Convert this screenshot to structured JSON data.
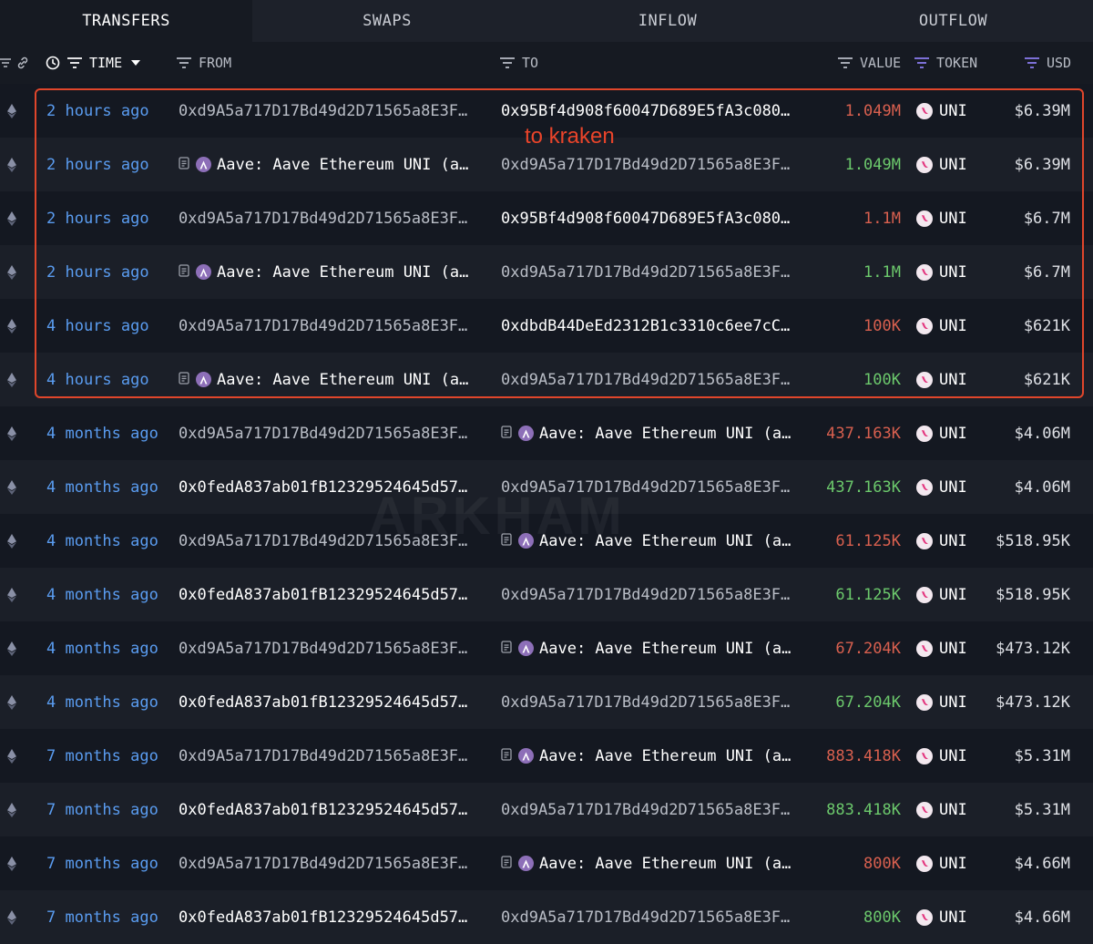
{
  "tabs": [
    "TRANSFERS",
    "SWAPS",
    "INFLOW",
    "OUTFLOW"
  ],
  "active_tab": "TRANSFERS",
  "header": {
    "time": "TIME",
    "from": "FROM",
    "to": "TO",
    "value": "VALUE",
    "token": "TOKEN",
    "usd": "USD"
  },
  "annotation": "to kraken",
  "watermark": "ARKHAM",
  "colors": {
    "out": "#d9604f",
    "in": "#6cc96c",
    "time_link": "#5a9cf0",
    "highlight": "#e0462b"
  },
  "rows": [
    {
      "time": "2 hours ago",
      "from": "0xd9A5a717D17Bd49d2D71565a8E3F…",
      "from_type": "addr",
      "to": "0x95Bf4d908f60047D689E5fA3c080…",
      "to_type": "addr-bold",
      "value": "1.049M",
      "direction": "out",
      "token": "UNI",
      "usd": "$6.39M"
    },
    {
      "time": "2 hours ago",
      "from": "Aave: Aave Ethereum UNI (a…",
      "from_type": "entity",
      "to": "0xd9A5a717D17Bd49d2D71565a8E3F…",
      "to_type": "addr",
      "value": "1.049M",
      "direction": "in",
      "token": "UNI",
      "usd": "$6.39M"
    },
    {
      "time": "2 hours ago",
      "from": "0xd9A5a717D17Bd49d2D71565a8E3F…",
      "from_type": "addr",
      "to": "0x95Bf4d908f60047D689E5fA3c080…",
      "to_type": "addr-bold",
      "value": "1.1M",
      "direction": "out",
      "token": "UNI",
      "usd": "$6.7M"
    },
    {
      "time": "2 hours ago",
      "from": "Aave: Aave Ethereum UNI (a…",
      "from_type": "entity",
      "to": "0xd9A5a717D17Bd49d2D71565a8E3F…",
      "to_type": "addr",
      "value": "1.1M",
      "direction": "in",
      "token": "UNI",
      "usd": "$6.7M"
    },
    {
      "time": "4 hours ago",
      "from": "0xd9A5a717D17Bd49d2D71565a8E3F…",
      "from_type": "addr",
      "to": "0xdbdB44DeEd2312B1c3310c6ee7cC…",
      "to_type": "addr-bold",
      "value": "100K",
      "direction": "out",
      "token": "UNI",
      "usd": "$621K"
    },
    {
      "time": "4 hours ago",
      "from": "Aave: Aave Ethereum UNI (a…",
      "from_type": "entity",
      "to": "0xd9A5a717D17Bd49d2D71565a8E3F…",
      "to_type": "addr",
      "value": "100K",
      "direction": "in",
      "token": "UNI",
      "usd": "$621K"
    },
    {
      "time": "4 months ago",
      "from": "0xd9A5a717D17Bd49d2D71565a8E3F…",
      "from_type": "addr",
      "to": "Aave: Aave Ethereum UNI (a…",
      "to_type": "entity",
      "value": "437.163K",
      "direction": "out",
      "token": "UNI",
      "usd": "$4.06M"
    },
    {
      "time": "4 months ago",
      "from": "0x0fedA837ab01fB12329524645d57…",
      "from_type": "addr-bold",
      "to": "0xd9A5a717D17Bd49d2D71565a8E3F…",
      "to_type": "addr",
      "value": "437.163K",
      "direction": "in",
      "token": "UNI",
      "usd": "$4.06M"
    },
    {
      "time": "4 months ago",
      "from": "0xd9A5a717D17Bd49d2D71565a8E3F…",
      "from_type": "addr",
      "to": "Aave: Aave Ethereum UNI (a…",
      "to_type": "entity",
      "value": "61.125K",
      "direction": "out",
      "token": "UNI",
      "usd": "$518.95K"
    },
    {
      "time": "4 months ago",
      "from": "0x0fedA837ab01fB12329524645d57…",
      "from_type": "addr-bold",
      "to": "0xd9A5a717D17Bd49d2D71565a8E3F…",
      "to_type": "addr",
      "value": "61.125K",
      "direction": "in",
      "token": "UNI",
      "usd": "$518.95K"
    },
    {
      "time": "4 months ago",
      "from": "0xd9A5a717D17Bd49d2D71565a8E3F…",
      "from_type": "addr",
      "to": "Aave: Aave Ethereum UNI (a…",
      "to_type": "entity",
      "value": "67.204K",
      "direction": "out",
      "token": "UNI",
      "usd": "$473.12K"
    },
    {
      "time": "4 months ago",
      "from": "0x0fedA837ab01fB12329524645d57…",
      "from_type": "addr-bold",
      "to": "0xd9A5a717D17Bd49d2D71565a8E3F…",
      "to_type": "addr",
      "value": "67.204K",
      "direction": "in",
      "token": "UNI",
      "usd": "$473.12K"
    },
    {
      "time": "7 months ago",
      "from": "0xd9A5a717D17Bd49d2D71565a8E3F…",
      "from_type": "addr",
      "to": "Aave: Aave Ethereum UNI (a…",
      "to_type": "entity",
      "value": "883.418K",
      "direction": "out",
      "token": "UNI",
      "usd": "$5.31M"
    },
    {
      "time": "7 months ago",
      "from": "0x0fedA837ab01fB12329524645d57…",
      "from_type": "addr-bold",
      "to": "0xd9A5a717D17Bd49d2D71565a8E3F…",
      "to_type": "addr",
      "value": "883.418K",
      "direction": "in",
      "token": "UNI",
      "usd": "$5.31M"
    },
    {
      "time": "7 months ago",
      "from": "0xd9A5a717D17Bd49d2D71565a8E3F…",
      "from_type": "addr",
      "to": "Aave: Aave Ethereum UNI (a…",
      "to_type": "entity",
      "value": "800K",
      "direction": "out",
      "token": "UNI",
      "usd": "$4.66M"
    },
    {
      "time": "7 months ago",
      "from": "0x0fedA837ab01fB12329524645d57…",
      "from_type": "addr-bold",
      "to": "0xd9A5a717D17Bd49d2D71565a8E3F…",
      "to_type": "addr",
      "value": "800K",
      "direction": "in",
      "token": "UNI",
      "usd": "$4.66M"
    }
  ]
}
